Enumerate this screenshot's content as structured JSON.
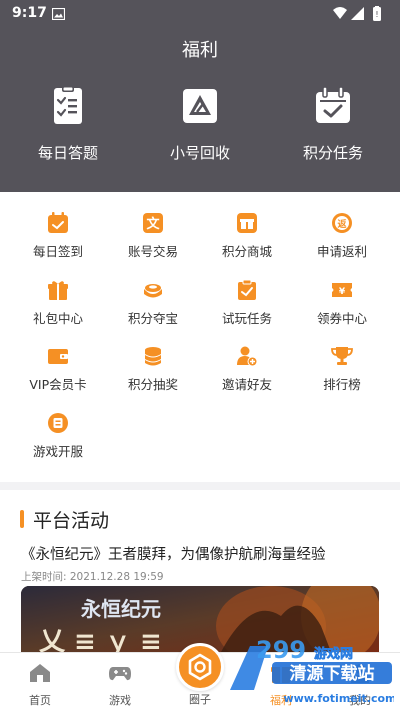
{
  "status": {
    "time": "9:17"
  },
  "header": {
    "title": "福利"
  },
  "top_actions": [
    {
      "label": "每日答题",
      "icon": "checklist-icon"
    },
    {
      "label": "小号回收",
      "icon": "recycle-triangle-icon"
    },
    {
      "label": "积分任务",
      "icon": "calendar-check-icon"
    }
  ],
  "grid": [
    {
      "label": "每日签到",
      "icon": "calendar-sign-icon"
    },
    {
      "label": "账号交易",
      "icon": "trade-icon"
    },
    {
      "label": "积分商城",
      "icon": "gift-box-icon"
    },
    {
      "label": "申请返利",
      "icon": "rebate-icon"
    },
    {
      "label": "礼包中心",
      "icon": "gift-pack-icon"
    },
    {
      "label": "积分夺宝",
      "icon": "treasure-icon"
    },
    {
      "label": "试玩任务",
      "icon": "clipboard-check-icon"
    },
    {
      "label": "领券中心",
      "icon": "coupon-icon"
    },
    {
      "label": "VIP会员卡",
      "icon": "wallet-card-icon"
    },
    {
      "label": "积分抽奖",
      "icon": "coin-stack-icon"
    },
    {
      "label": "邀请好友",
      "icon": "add-user-icon"
    },
    {
      "label": "排行榜",
      "icon": "trophy-icon"
    },
    {
      "label": "游戏开服",
      "icon": "server-icon"
    }
  ],
  "activity": {
    "section_title": "平台活动",
    "title": "《永恒纪元》王者膜拜，为偶像护航刷海量经验",
    "time": "上架时间: 2021.12.28 19:59",
    "banner_text": "永恒纪元"
  },
  "tabs": [
    {
      "label": "首页",
      "icon": "home-icon"
    },
    {
      "label": "游戏",
      "icon": "gamepad-icon"
    },
    {
      "label": "圈子",
      "icon": "hexagon-icon"
    },
    {
      "label": "福利",
      "icon": "gift-icon"
    },
    {
      "label": "我的",
      "icon": "user-icon"
    }
  ],
  "watermark": {
    "line1": "游戏网",
    "line2": "清源下载站",
    "line3": "www.fotimeit.com"
  },
  "colors": {
    "accent": "#f59024",
    "header_bg": "#55535a"
  }
}
